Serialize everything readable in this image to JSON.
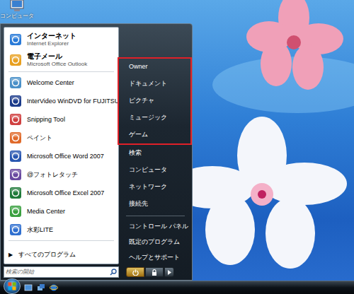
{
  "desktop": {
    "icons": [
      {
        "label": "コンピュータ"
      }
    ]
  },
  "start_menu": {
    "pinned": [
      {
        "title": "インターネット",
        "subtitle": "Internet Explorer"
      },
      {
        "title": "電子メール",
        "subtitle": "Microsoft Office Outlook"
      }
    ],
    "recent": [
      "Welcome Center",
      "InterVideo WinDVD for FUJITSU",
      "Snipping Tool",
      "ペイント",
      "Microsoft Office Word 2007",
      "@フォトレタッチ",
      "Microsoft Office Excel 2007",
      "Media Center",
      "水彩LITE"
    ],
    "all_programs": {
      "arrow": "▶",
      "label": "すべてのプログラム"
    },
    "search": {
      "placeholder": "検索の開始"
    },
    "places": [
      {
        "label": "Owner",
        "highlighted": true
      },
      {
        "label": "ドキュメント",
        "highlighted": true
      },
      {
        "label": "ピクチャ",
        "highlighted": true
      },
      {
        "label": "ミュージック",
        "highlighted": true
      },
      {
        "label": "ゲーム",
        "highlighted": true
      },
      {
        "label": "検索",
        "highlighted": false
      },
      {
        "label": "コンピュータ",
        "highlighted": false
      },
      {
        "label": "ネットワーク",
        "highlighted": false
      },
      {
        "label": "接続先",
        "highlighted": false
      }
    ],
    "system": [
      "コントロール パネル",
      "既定のプログラム",
      "ヘルプとサポート"
    ]
  }
}
